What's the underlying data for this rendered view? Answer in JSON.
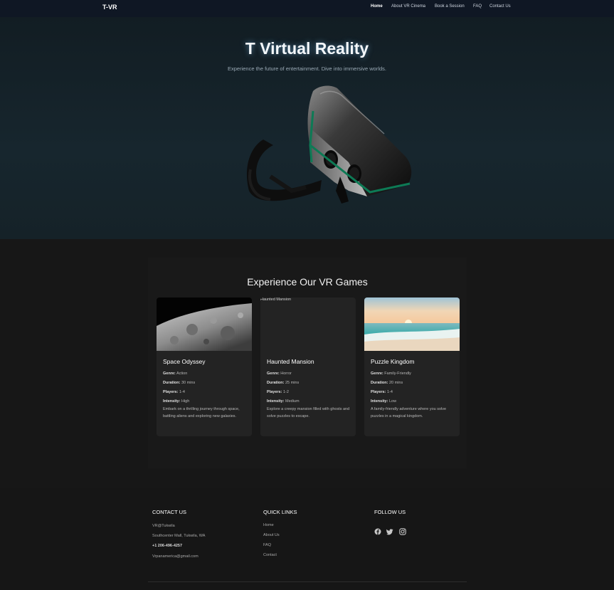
{
  "nav": {
    "brand": "T-VR",
    "links": [
      "Home",
      "About VR Cinema",
      "Book a Session",
      "FAQ",
      "Contact Us"
    ]
  },
  "hero": {
    "title": "T Virtual Reality",
    "subtitle": "Experience the future of entertainment. Dive into immersive worlds."
  },
  "games": {
    "title": "Experience Our VR Games",
    "labels": {
      "genre": "Genre:",
      "duration": "Duration:",
      "players": "Players:",
      "intensity": "Intensity:"
    },
    "cards": [
      {
        "title": "Space Odyssey",
        "genre": "Action",
        "duration": "30 mins",
        "players": "1-4",
        "intensity": "High",
        "description": "Embark on a thrilling journey through space, battling aliens and exploring new galaxies."
      },
      {
        "title": "Haunted Mansion",
        "image_alt": "Haunted Mansion",
        "genre": "Horror",
        "duration": "25 mins",
        "players": "1-2",
        "intensity": "Medium",
        "description": "Explore a creepy mansion filled with ghosts and solve puzzles to escape."
      },
      {
        "title": "Puzzle Kingdom",
        "genre": "Family-Friendly",
        "duration": "20 mins",
        "players": "1-4",
        "intensity": "Low",
        "description": "A family-friendly adventure where you solve puzzles in a magical kingdom."
      }
    ]
  },
  "footer": {
    "contact": {
      "heading": "CONTACT US",
      "lines": [
        "VR@Tukwila",
        "Southcenter Mall, Tukwila, WA",
        "+1 206-496-4257",
        "Vrpanamerica@gmail.com"
      ]
    },
    "quick_links": {
      "heading": "QUICK LINKS",
      "links": [
        "Home",
        "About Us",
        "FAQ",
        "Contact"
      ]
    },
    "follow": {
      "heading": "FOLLOW US",
      "icons": [
        "facebook-icon",
        "twitter-icon",
        "instagram-icon"
      ]
    }
  },
  "colors": {
    "nav_bg": "#0f1724",
    "hero_bg": "#17262e",
    "page_bg": "#1a1a1a",
    "card_bg": "#232323",
    "headset_accent": "#0d7a55"
  }
}
